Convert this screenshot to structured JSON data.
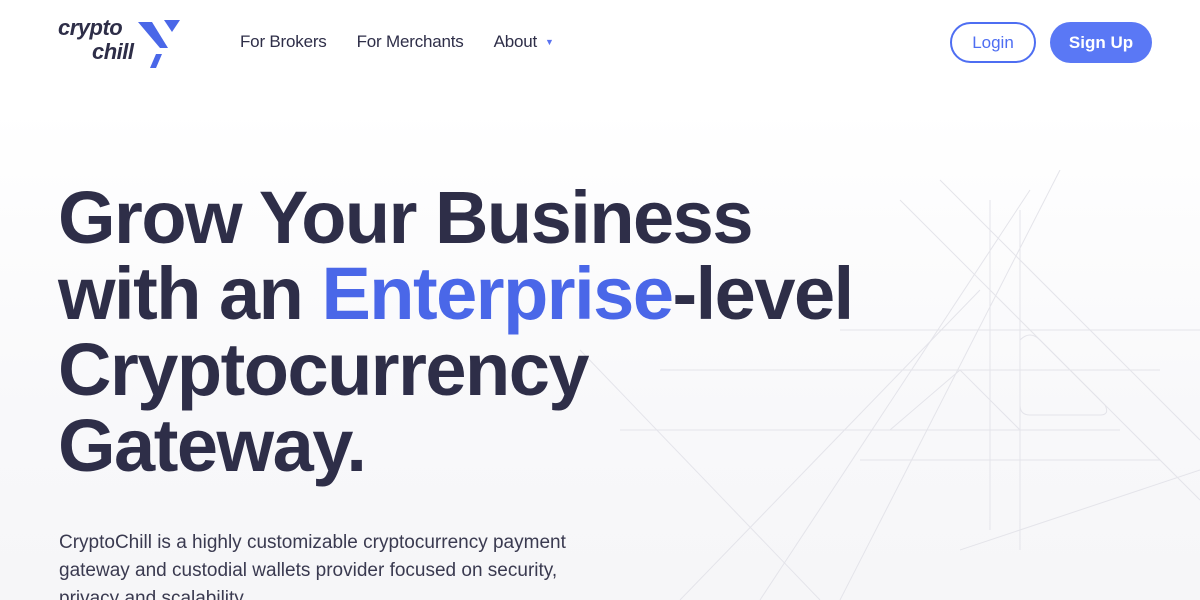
{
  "brand": {
    "line1": "crypto",
    "line2": "chill"
  },
  "nav": {
    "brokers": "For Brokers",
    "merchants": "For Merchants",
    "about": "About"
  },
  "auth": {
    "login": "Login",
    "signup": "Sign Up"
  },
  "hero": {
    "line1": "Grow Your Business",
    "line2_pre": "with an ",
    "line2_accent": "Enterprise",
    "line2_post": "-level",
    "line3": "Cryptocurrency",
    "line4": "Gateway.",
    "lead": "CryptoChill is a highly customizable cryptocurrency payment gateway and custodial wallets provider focused on security, privacy and scalability."
  },
  "colors": {
    "accent": "#4a67e8",
    "button": "#5a78f5",
    "text": "#2e2e48"
  },
  "icons": {
    "about_caret": "caret-down-icon",
    "logo": "logo-arrow-icon"
  }
}
